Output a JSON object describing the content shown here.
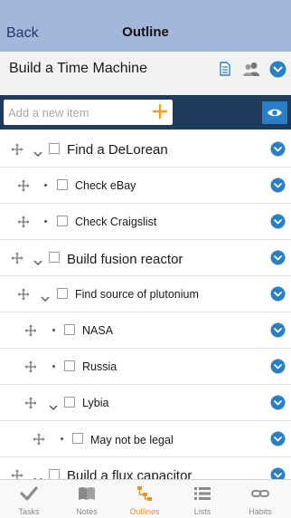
{
  "nav": {
    "back_label": "Back",
    "title": "Outline"
  },
  "project": {
    "title": "Build a Time Machine",
    "icons": [
      "notes-icon",
      "people-icon",
      "chevron-down-icon"
    ]
  },
  "add_item": {
    "placeholder": "Add a new item",
    "add_icon": "plus-icon",
    "view_icon": "eye-icon"
  },
  "outline_items": [
    {
      "label": "Find a DeLorean",
      "level": 1,
      "expanded": true,
      "checked": false
    },
    {
      "label": "Check eBay",
      "level": 2,
      "expanded": null,
      "checked": false
    },
    {
      "label": "Check Craigslist",
      "level": 2,
      "expanded": null,
      "checked": false
    },
    {
      "label": "Build fusion reactor",
      "level": 1,
      "expanded": true,
      "checked": false
    },
    {
      "label": "Find source of plutonium",
      "level": 2,
      "expanded": true,
      "checked": false
    },
    {
      "label": "NASA",
      "level": 3,
      "expanded": null,
      "checked": false
    },
    {
      "label": "Russia",
      "level": 3,
      "expanded": null,
      "checked": false
    },
    {
      "label": "Lybia",
      "level": 3,
      "expanded": true,
      "checked": false
    },
    {
      "label": "May not be legal",
      "level": 4,
      "expanded": null,
      "checked": false
    },
    {
      "label": "Build a flux capacitor",
      "level": 1,
      "expanded": true,
      "checked": false
    }
  ],
  "tabbar": {
    "active": "Outlines",
    "tabs": [
      {
        "label": "Tasks",
        "icon": "checkmark-icon"
      },
      {
        "label": "Notes",
        "icon": "book-icon"
      },
      {
        "label": "Outlines",
        "icon": "outline-tree-icon"
      },
      {
        "label": "Lists",
        "icon": "list-icon"
      },
      {
        "label": "Habits",
        "icon": "chain-icon"
      }
    ]
  },
  "colors": {
    "navbar": "#a5b6dc",
    "add_bar": "#1e3a5c",
    "accent_blue": "#2a7fc4",
    "add_plus": "#f0a020",
    "active_tab": "#e8962a"
  }
}
